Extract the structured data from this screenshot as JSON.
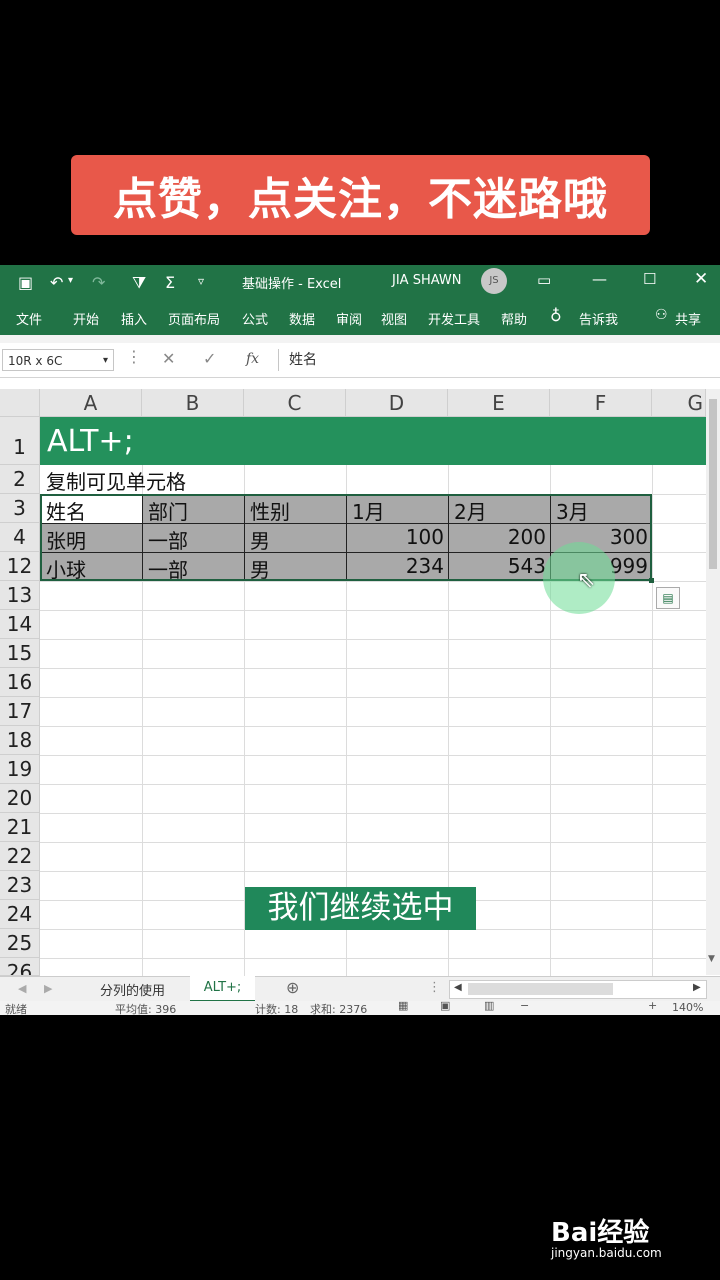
{
  "banner": {
    "text": "点赞，点关注，不迷路哦"
  },
  "titlebar": {
    "filename": "基础操作 - Excel",
    "user": "JIA SHAWN",
    "avatar": "JS"
  },
  "ribbon": {
    "tabs": [
      "文件",
      "开始",
      "插入",
      "页面布局",
      "公式",
      "数据",
      "审阅",
      "视图",
      "开发工具",
      "帮助",
      "告诉我",
      "共享"
    ]
  },
  "formula": {
    "namebox": "10R x 6C",
    "fx": "fx",
    "content": "姓名"
  },
  "columns": [
    "A",
    "B",
    "C",
    "D",
    "E",
    "F",
    "G"
  ],
  "rows": [
    "1",
    "2",
    "3",
    "4",
    "12",
    "13",
    "14",
    "15",
    "16",
    "17",
    "18",
    "19",
    "20",
    "21",
    "22",
    "23",
    "24",
    "25",
    "26"
  ],
  "sheet": {
    "r1": "ALT+;",
    "r2": "复制可见单元格",
    "headers": [
      "姓名",
      "部门",
      "性别",
      "1月",
      "2月",
      "3月"
    ],
    "row4": [
      "张明",
      "一部",
      "男",
      "100",
      "200",
      "300"
    ],
    "row12": [
      "小球",
      "一部",
      "男",
      "234",
      "543",
      "999"
    ]
  },
  "tabs": {
    "sheet1": "分列的使用",
    "sheet2": "ALT+;"
  },
  "status": {
    "ready": "就绪",
    "avg": "平均值: 396",
    "count": "计数: 18",
    "sum": "求和: 2376",
    "zoom": "140%"
  },
  "subtitle": "我们继续选中",
  "watermark": {
    "brand": "Bai经验",
    "url": "jingyan.baidu.com"
  },
  "colors": {
    "excel_green": "#217346",
    "header_green": "#24915c",
    "banner_red": "#e8584a"
  }
}
